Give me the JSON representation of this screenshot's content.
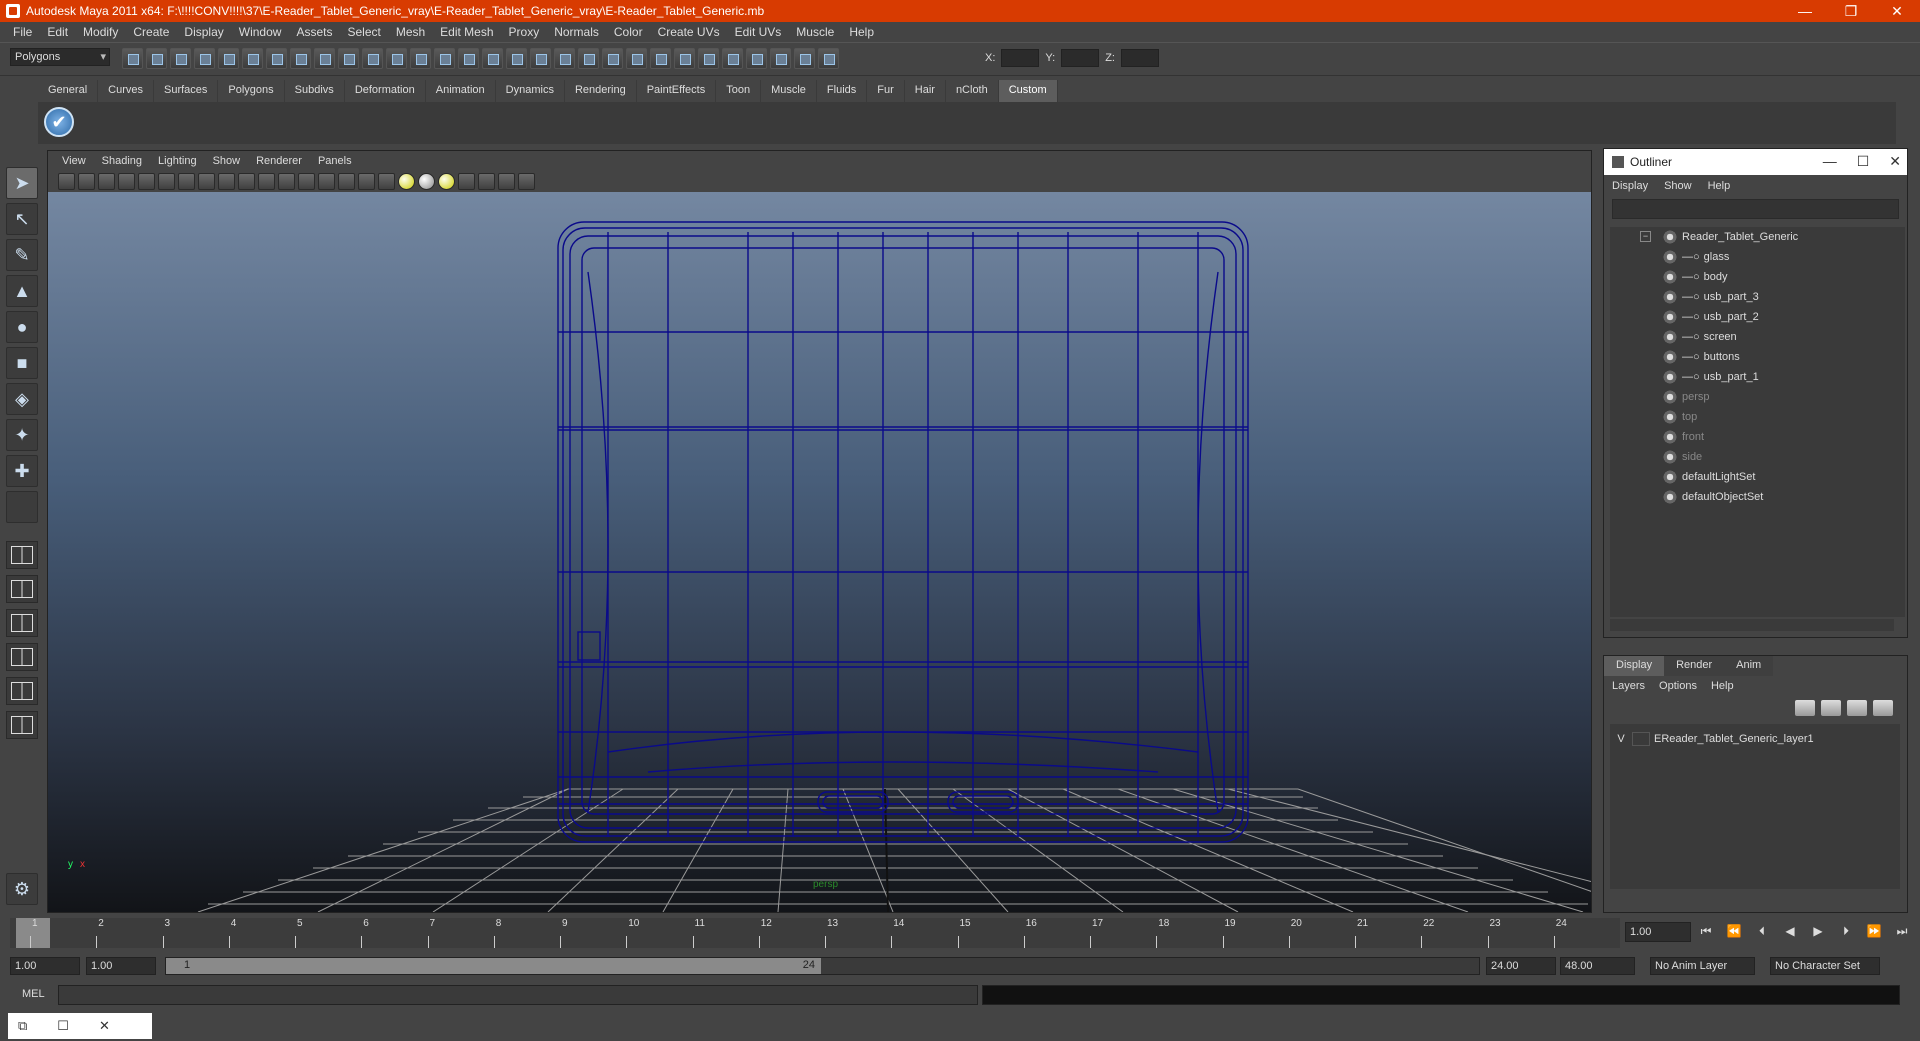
{
  "window": {
    "title": "Autodesk Maya 2011 x64: F:\\!!!!CONV!!!!\\37\\E-Reader_Tablet_Generic_vray\\E-Reader_Tablet_Generic_vray\\E-Reader_Tablet_Generic.mb",
    "min": "—",
    "max": "❐",
    "close": "✕"
  },
  "menubar": [
    "File",
    "Edit",
    "Modify",
    "Create",
    "Display",
    "Window",
    "Assets",
    "Select",
    "Mesh",
    "Edit Mesh",
    "Proxy",
    "Normals",
    "Color",
    "Create UVs",
    "Edit UVs",
    "Muscle",
    "Help"
  ],
  "status": {
    "mode": "Polygons",
    "x_label": "X:",
    "y_label": "Y:",
    "z_label": "Z:"
  },
  "shelf": {
    "tabs": [
      "General",
      "Curves",
      "Surfaces",
      "Polygons",
      "Subdivs",
      "Deformation",
      "Animation",
      "Dynamics",
      "Rendering",
      "PaintEffects",
      "Toon",
      "Muscle",
      "Fluids",
      "Fur",
      "Hair",
      "nCloth",
      "Custom"
    ],
    "active": "Custom"
  },
  "viewport": {
    "menu": [
      "View",
      "Shading",
      "Lighting",
      "Show",
      "Renderer",
      "Panels"
    ],
    "camera_label": "persp",
    "wire_color": "#0a0a8a"
  },
  "outliner": {
    "title": "Outliner",
    "menu": [
      "Display",
      "Show",
      "Help"
    ],
    "root": "Reader_Tablet_Generic",
    "children": [
      "glass",
      "body",
      "usb_part_3",
      "usb_part_2",
      "screen",
      "buttons",
      "usb_part_1"
    ],
    "cameras": [
      "persp",
      "top",
      "front",
      "side"
    ],
    "sets": [
      "defaultLightSet",
      "defaultObjectSet"
    ]
  },
  "layers": {
    "tabs": [
      "Display",
      "Render",
      "Anim"
    ],
    "active": "Display",
    "menu": [
      "Layers",
      "Options",
      "Help"
    ],
    "layer_visible": "V",
    "layer_name": "EReader_Tablet_Generic_layer1"
  },
  "timeline": {
    "ticks": [
      "1",
      "2",
      "3",
      "4",
      "5",
      "6",
      "7",
      "8",
      "9",
      "10",
      "11",
      "12",
      "13",
      "14",
      "15",
      "16",
      "17",
      "18",
      "19",
      "20",
      "21",
      "22",
      "23",
      "24"
    ],
    "current_frame_marker": "1",
    "current_frame": "1.00"
  },
  "range": {
    "start": "1.00",
    "start_inner": "1.00",
    "handle_start": "1",
    "handle_end": "24",
    "end_inner": "24.00",
    "end": "48.00",
    "anim_layer": "No Anim Layer",
    "char_set": "No Character Set"
  },
  "cmdline": {
    "label": "MEL"
  }
}
